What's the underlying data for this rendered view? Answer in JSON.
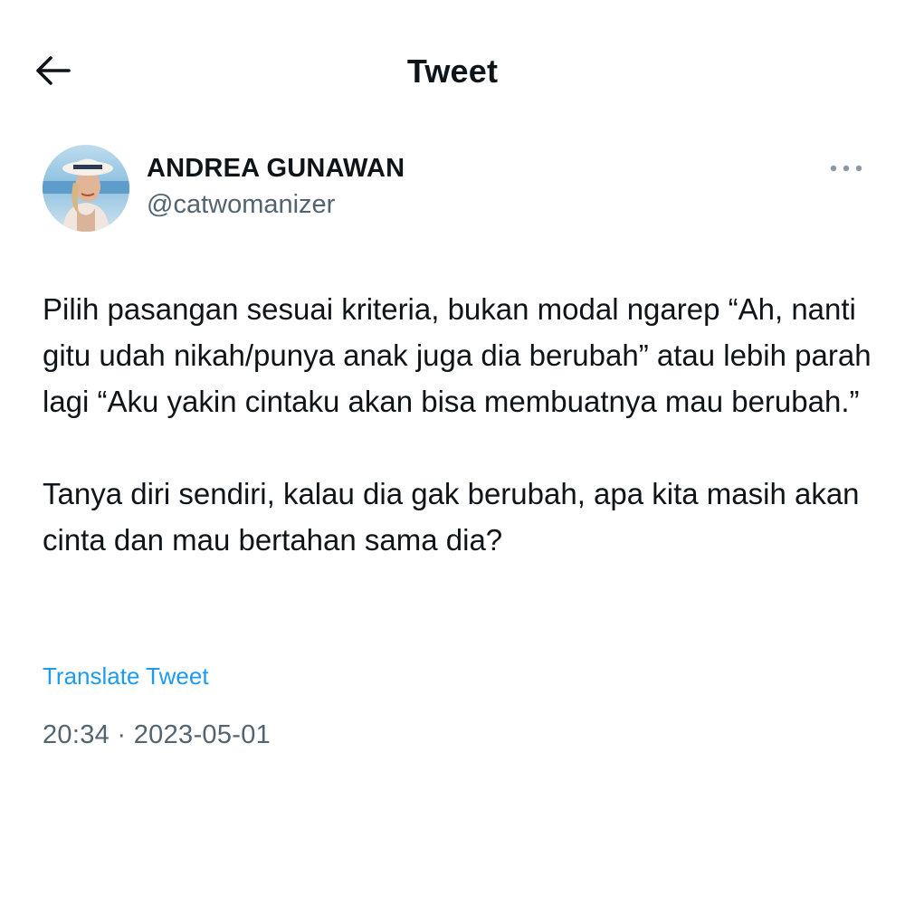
{
  "header": {
    "title": "Tweet",
    "back_icon": "arrow-left-icon"
  },
  "author": {
    "name": "ANDREA GUNAWAN",
    "handle": "@catwomanizer",
    "avatar_icon": "profile-photo"
  },
  "tweet": {
    "paragraphs": [
      "Pilih pasangan sesuai kriteria, bukan modal ngarep “Ah, nanti gitu udah nikah/punya anak juga dia berubah” atau lebih parah lagi “Aku yakin cintaku akan bisa membuatnya mau berubah.”",
      "Tanya diri sendiri, kalau dia gak berubah, apa kita masih akan cinta dan mau bertahan sama dia?"
    ],
    "translate_label": "Translate Tweet",
    "timestamp": "20:34 · 2023-05-01"
  },
  "colors": {
    "text": "#0f1419",
    "secondary": "#536471",
    "link": "#1d9bf0"
  }
}
